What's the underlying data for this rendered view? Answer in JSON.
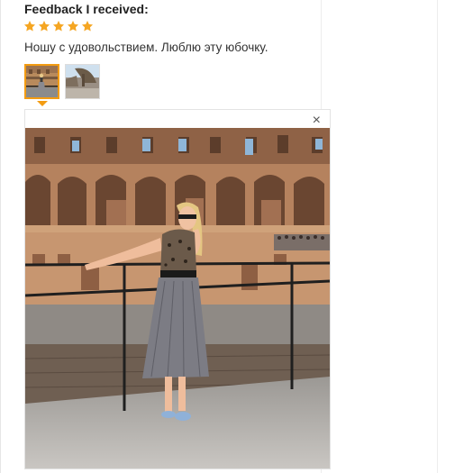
{
  "feedback": {
    "heading": "Feedback I received:",
    "rating": 5,
    "star_color": "#f5a623",
    "review_text": "Ношу с удовольствием. Люблю эту юбочку.",
    "thumbnails": [
      {
        "name": "photo-thumbnail-1",
        "selected": true
      },
      {
        "name": "photo-thumbnail-2",
        "selected": false
      }
    ],
    "viewer": {
      "close_icon": "×",
      "accent_color": "#f39c12"
    }
  }
}
